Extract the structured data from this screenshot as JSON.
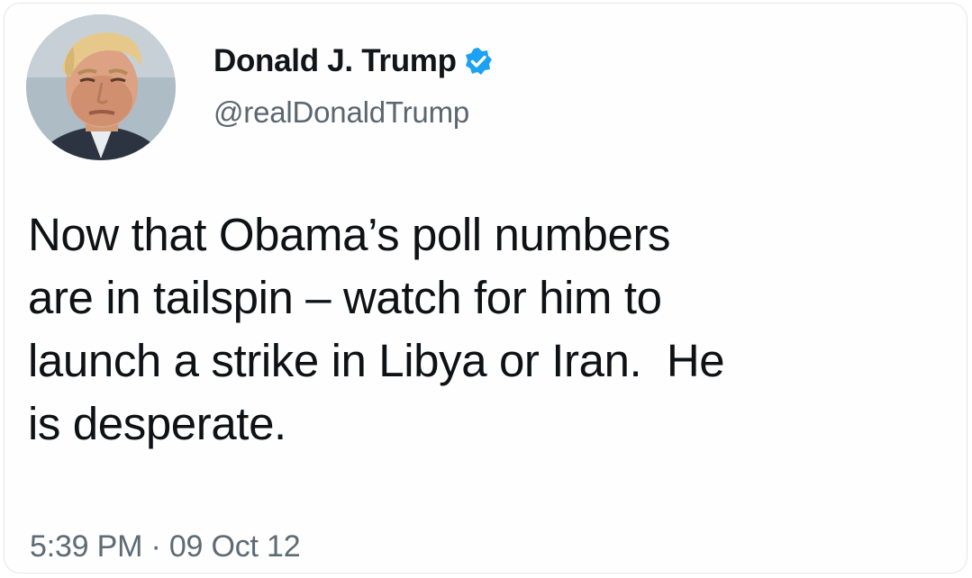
{
  "tweet": {
    "author": {
      "display_name": "Donald J. Trump",
      "handle": "@realDonaldTrump",
      "verified": true,
      "verified_icon": "verified-badge-icon",
      "avatar": "profile-photo"
    },
    "text_lines": [
      "Now that Obama’s poll numbers",
      "are in tailspin – watch for him to",
      "launch a strike in Libya or Iran.  He",
      "is desperate."
    ],
    "time": "5:39 PM",
    "separator": "·",
    "date": "09 Oct 12",
    "timestamp": "5:39 PM · 09 Oct 12"
  },
  "colors": {
    "text": "#0f1215",
    "secondary_text": "#5b6670",
    "verified_blue": "#1da1f2",
    "background": "#ffffff"
  }
}
